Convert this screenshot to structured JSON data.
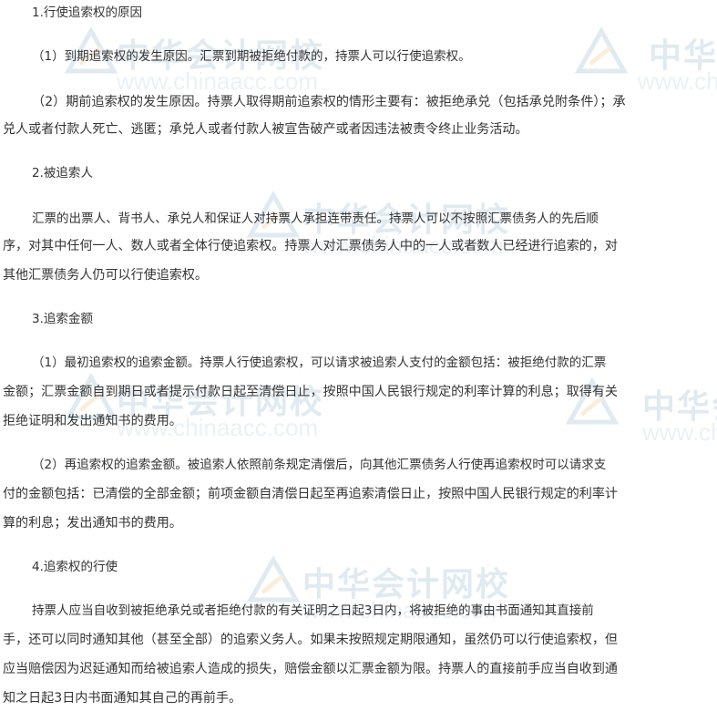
{
  "watermark": {
    "brand": "中华会计网校",
    "brand_cut": "中华",
    "brand_cut2": "中华会",
    "url": "www.chinaacc.com",
    "url_cut": "www.chi",
    "url_cut2": "www.ch"
  },
  "sections": {
    "s1": {
      "heading": "1.行使追索权的原因",
      "p1": "（1）到期追索权的发生原因。汇票到期被拒绝付款的，持票人可以行使追索权。",
      "p2_l1": "（2）期前追索权的发生原因。持票人取得期前追索权的情形主要有：被拒绝承兑（包括承兑附条件）；承",
      "p2_l2": "兑人或者付款人死亡、逃匿；承兑人或者付款人被宣告破产或者因违法被责令终止业务活动。"
    },
    "s2": {
      "heading": "2.被追索人",
      "l1": "汇票的出票人、背书人、承兑人和保证人对持票人承担连带责任。持票人可以不按照汇票债务人的先后顺",
      "l2": "序，对其中任何一人、数人或者全体行使追索权。持票人对汇票债务人中的一人或者数人已经进行追索的，对",
      "l3": "其他汇票债务人仍可以行使追索权。"
    },
    "s3": {
      "heading": "3.追索金额",
      "p1_l1": "（1）最初追索权的追索金额。持票人行使追索权，可以请求被追索人支付的金额包括：被拒绝付款的汇票",
      "p1_l2": "金额；汇票金额自到期日或者提示付款日起至清偿日止，按照中国人民银行规定的利率计算的利息；取得有关",
      "p1_l3": "拒绝证明和发出通知书的费用。",
      "p2_l1": "（2）再追索权的追索金额。被追索人依照前条规定清偿后，向其他汇票债务人行使再追索权时可以请求支",
      "p2_l2": "付的金额包括：已清偿的全部金额；前项金额自清偿日起至再追索清偿日止，按照中国人民银行规定的利率计",
      "p2_l3": "算的利息；发出通知书的费用。"
    },
    "s4": {
      "heading": "4.追索权的行使",
      "l1": "持票人应当自收到被拒绝承兑或者拒绝付款的有关证明之日起3日内，将被拒绝的事由书面通知其直接前",
      "l2": "手，还可以同时通知其他（甚至全部）的追索义务人。如果未按照规定期限通知，虽然仍可以行使追索权，但",
      "l3": "应当赔偿因为迟延通知而给被追索人造成的损失，赔偿金额以汇票金额为限。持票人的直接前手应当自收到通",
      "l4": "知之日起3日内书面通知其自己的再前手。"
    }
  }
}
